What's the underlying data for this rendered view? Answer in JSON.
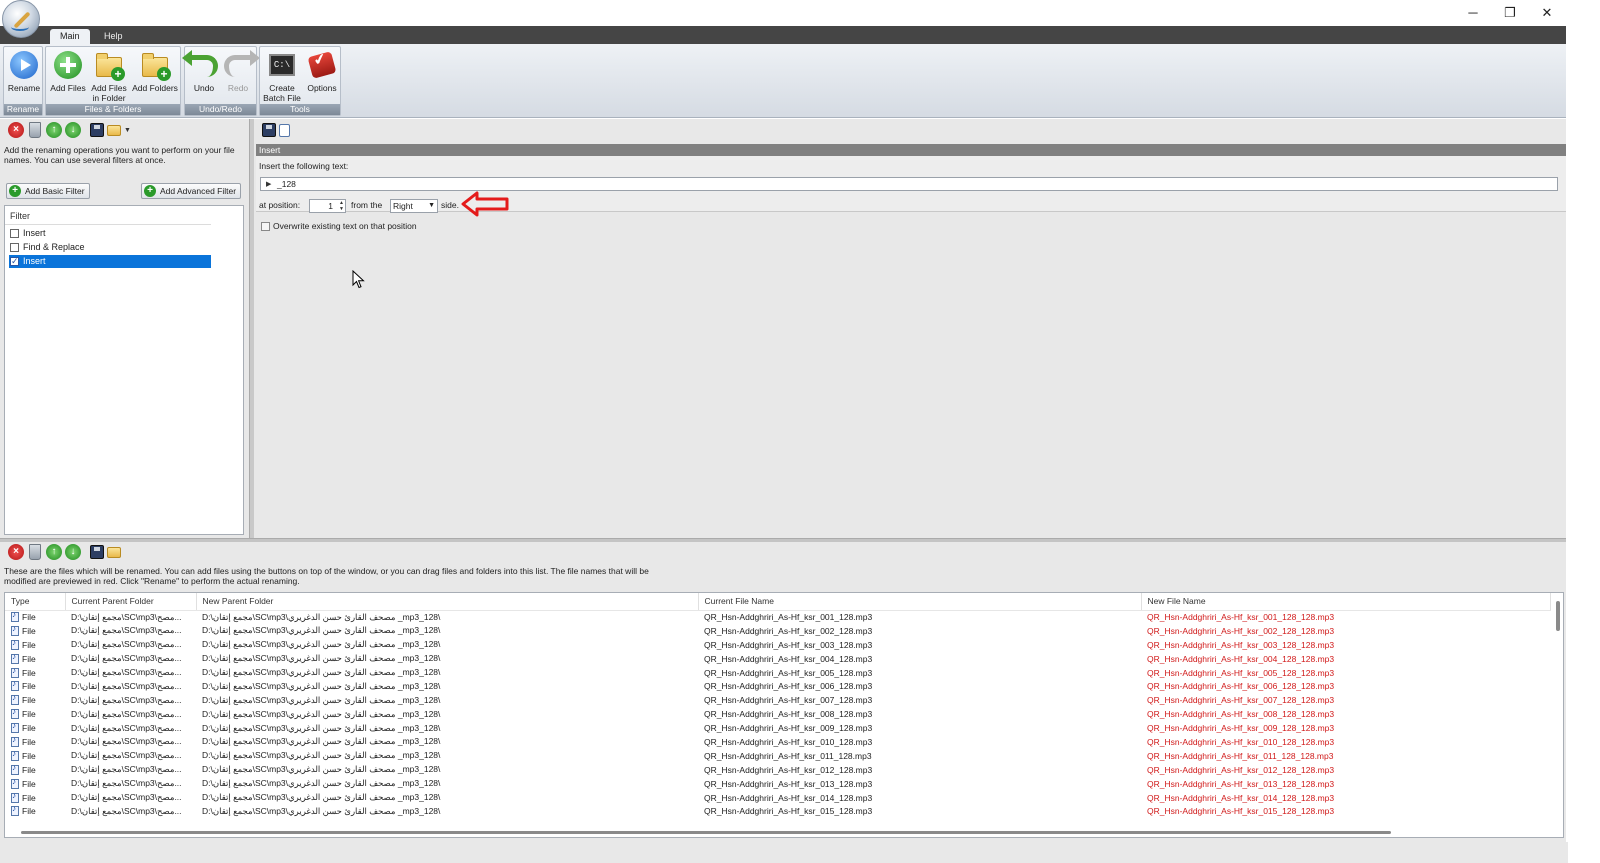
{
  "window": {
    "minimize": "─",
    "restore": "❐",
    "close": "✕"
  },
  "ribbon_tabs": [
    "Main",
    "Help"
  ],
  "ribbon": {
    "rename_group": "Rename",
    "files_group": "Files & Folders",
    "undo_group": "Undo/Redo",
    "tools_group": "Tools",
    "rename": "Rename",
    "add_files": "Add Files",
    "add_files_in_folder_1": "Add Files",
    "add_files_in_folder_2": "in Folder",
    "add_folders": "Add Folders",
    "undo": "Undo",
    "redo": "Redo",
    "create_batch_1": "Create",
    "create_batch_2": "Batch File",
    "options": "Options",
    "cmd_icon_text": "C:\\"
  },
  "left": {
    "hint": "Add the renaming operations you want to perform on your file names. You can use several filters at once.",
    "add_basic": "Add Basic Filter",
    "add_advanced": "Add Advanced Filter",
    "filter_header": "Filter",
    "filters": [
      {
        "label": "Insert",
        "checked": false
      },
      {
        "label": "Find & Replace",
        "checked": false
      },
      {
        "label": "Insert",
        "checked": true
      }
    ]
  },
  "insert": {
    "header": "Insert",
    "label": "Insert the following text:",
    "text": "_128",
    "at_position": "at position:",
    "position": "1",
    "from_the": "from the",
    "side_value": "Right",
    "side": "side.",
    "overwrite": "Overwrite existing text on that position"
  },
  "bottom": {
    "hint": "These are the files which will be renamed. You can add files using the buttons on top of the window, or you can drag files and folders into this list. The file names that will be modified are previewed in red. Click \"Rename\" to perform the actual renaming.",
    "columns": [
      "Type",
      "Current Parent Folder",
      "New Parent Folder",
      "Current File Name",
      "New File Name"
    ],
    "rows": [
      {
        "type": "File",
        "cur_folder": "D:\\مجمع إتقان\\SC\\mp3\\مصح...",
        "new_folder": "D:\\مجمع إتقان\\SC\\mp3\\مصحف القارئ حسن الدغريري _mp3_128\\",
        "cur_name": "QR_Hsn-Addghriri_As-Hf_ksr_001_128.mp3",
        "new_name": "QR_Hsn-Addghriri_As-Hf_ksr_001_128_128.mp3"
      },
      {
        "type": "File",
        "cur_folder": "D:\\مجمع إتقان\\SC\\mp3\\مصح...",
        "new_folder": "D:\\مجمع إتقان\\SC\\mp3\\مصحف القارئ حسن الدغريري _mp3_128\\",
        "cur_name": "QR_Hsn-Addghriri_As-Hf_ksr_002_128.mp3",
        "new_name": "QR_Hsn-Addghriri_As-Hf_ksr_002_128_128.mp3"
      },
      {
        "type": "File",
        "cur_folder": "D:\\مجمع إتقان\\SC\\mp3\\مصح...",
        "new_folder": "D:\\مجمع إتقان\\SC\\mp3\\مصحف القارئ حسن الدغريري _mp3_128\\",
        "cur_name": "QR_Hsn-Addghriri_As-Hf_ksr_003_128.mp3",
        "new_name": "QR_Hsn-Addghriri_As-Hf_ksr_003_128_128.mp3"
      },
      {
        "type": "File",
        "cur_folder": "D:\\مجمع إتقان\\SC\\mp3\\مصح...",
        "new_folder": "D:\\مجمع إتقان\\SC\\mp3\\مصحف القارئ حسن الدغريري _mp3_128\\",
        "cur_name": "QR_Hsn-Addghriri_As-Hf_ksr_004_128.mp3",
        "new_name": "QR_Hsn-Addghriri_As-Hf_ksr_004_128_128.mp3"
      },
      {
        "type": "File",
        "cur_folder": "D:\\مجمع إتقان\\SC\\mp3\\مصح...",
        "new_folder": "D:\\مجمع إتقان\\SC\\mp3\\مصحف القارئ حسن الدغريري _mp3_128\\",
        "cur_name": "QR_Hsn-Addghriri_As-Hf_ksr_005_128.mp3",
        "new_name": "QR_Hsn-Addghriri_As-Hf_ksr_005_128_128.mp3"
      },
      {
        "type": "File",
        "cur_folder": "D:\\مجمع إتقان\\SC\\mp3\\مصح...",
        "new_folder": "D:\\مجمع إتقان\\SC\\mp3\\مصحف القارئ حسن الدغريري _mp3_128\\",
        "cur_name": "QR_Hsn-Addghriri_As-Hf_ksr_006_128.mp3",
        "new_name": "QR_Hsn-Addghriri_As-Hf_ksr_006_128_128.mp3"
      },
      {
        "type": "File",
        "cur_folder": "D:\\مجمع إتقان\\SC\\mp3\\مصح...",
        "new_folder": "D:\\مجمع إتقان\\SC\\mp3\\مصحف القارئ حسن الدغريري _mp3_128\\",
        "cur_name": "QR_Hsn-Addghriri_As-Hf_ksr_007_128.mp3",
        "new_name": "QR_Hsn-Addghriri_As-Hf_ksr_007_128_128.mp3"
      },
      {
        "type": "File",
        "cur_folder": "D:\\مجمع إتقان\\SC\\mp3\\مصح...",
        "new_folder": "D:\\مجمع إتقان\\SC\\mp3\\مصحف القارئ حسن الدغريري _mp3_128\\",
        "cur_name": "QR_Hsn-Addghriri_As-Hf_ksr_008_128.mp3",
        "new_name": "QR_Hsn-Addghriri_As-Hf_ksr_008_128_128.mp3"
      },
      {
        "type": "File",
        "cur_folder": "D:\\مجمع إتقان\\SC\\mp3\\مصح...",
        "new_folder": "D:\\مجمع إتقان\\SC\\mp3\\مصحف القارئ حسن الدغريري _mp3_128\\",
        "cur_name": "QR_Hsn-Addghriri_As-Hf_ksr_009_128.mp3",
        "new_name": "QR_Hsn-Addghriri_As-Hf_ksr_009_128_128.mp3"
      },
      {
        "type": "File",
        "cur_folder": "D:\\مجمع إتقان\\SC\\mp3\\مصح...",
        "new_folder": "D:\\مجمع إتقان\\SC\\mp3\\مصحف القارئ حسن الدغريري _mp3_128\\",
        "cur_name": "QR_Hsn-Addghriri_As-Hf_ksr_010_128.mp3",
        "new_name": "QR_Hsn-Addghriri_As-Hf_ksr_010_128_128.mp3"
      },
      {
        "type": "File",
        "cur_folder": "D:\\مجمع إتقان\\SC\\mp3\\مصح...",
        "new_folder": "D:\\مجمع إتقان\\SC\\mp3\\مصحف القارئ حسن الدغريري _mp3_128\\",
        "cur_name": "QR_Hsn-Addghriri_As-Hf_ksr_011_128.mp3",
        "new_name": "QR_Hsn-Addghriri_As-Hf_ksr_011_128_128.mp3"
      },
      {
        "type": "File",
        "cur_folder": "D:\\مجمع إتقان\\SC\\mp3\\مصح...",
        "new_folder": "D:\\مجمع إتقان\\SC\\mp3\\مصحف القارئ حسن الدغريري _mp3_128\\",
        "cur_name": "QR_Hsn-Addghriri_As-Hf_ksr_012_128.mp3",
        "new_name": "QR_Hsn-Addghriri_As-Hf_ksr_012_128_128.mp3"
      },
      {
        "type": "File",
        "cur_folder": "D:\\مجمع إتقان\\SC\\mp3\\مصح...",
        "new_folder": "D:\\مجمع إتقان\\SC\\mp3\\مصحف القارئ حسن الدغريري _mp3_128\\",
        "cur_name": "QR_Hsn-Addghriri_As-Hf_ksr_013_128.mp3",
        "new_name": "QR_Hsn-Addghriri_As-Hf_ksr_013_128_128.mp3"
      },
      {
        "type": "File",
        "cur_folder": "D:\\مجمع إتقان\\SC\\mp3\\مصح...",
        "new_folder": "D:\\مجمع إتقان\\SC\\mp3\\مصحف القارئ حسن الدغريري _mp3_128\\",
        "cur_name": "QR_Hsn-Addghriri_As-Hf_ksr_014_128.mp3",
        "new_name": "QR_Hsn-Addghriri_As-Hf_ksr_014_128_128.mp3"
      },
      {
        "type": "File",
        "cur_folder": "D:\\مجمع إتقان\\SC\\mp3\\مصح...",
        "new_folder": "D:\\مجمع إتقان\\SC\\mp3\\مصحف القارئ حسن الدغريري _mp3_128\\",
        "cur_name": "QR_Hsn-Addghriri_As-Hf_ksr_015_128.mp3",
        "new_name": "QR_Hsn-Addghriri_As-Hf_ksr_015_128_128.mp3"
      }
    ]
  },
  "colors": {
    "accent": "#0a74da",
    "preview_red": "#d11a1a",
    "arrow_red": "#e41b1b"
  }
}
